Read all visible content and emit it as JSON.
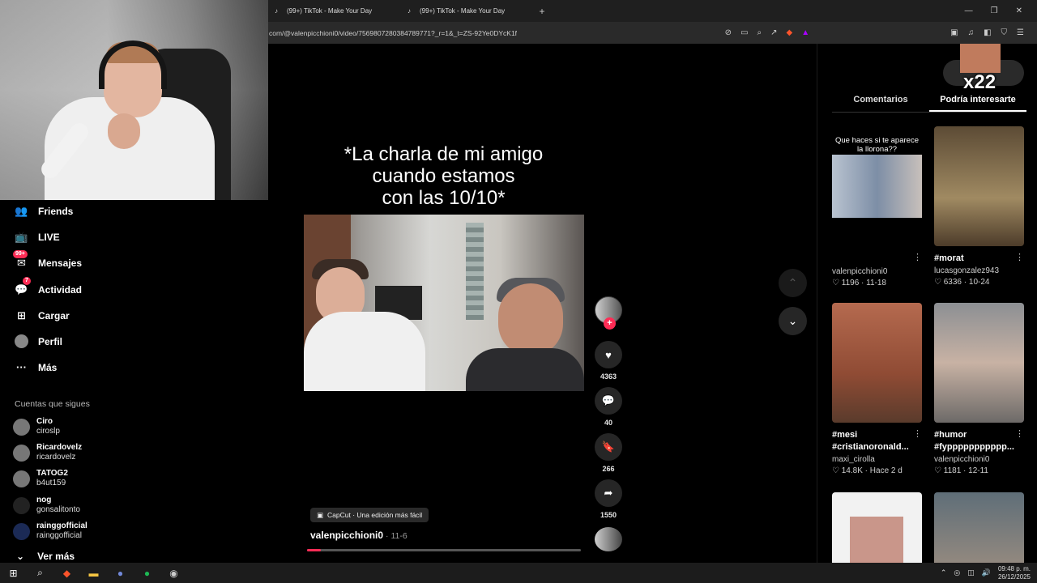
{
  "browser": {
    "tabs": [
      {
        "title": "(99+) TikTok - Make Your Day"
      },
      {
        "title": "(99+) TikTok - Make Your Day"
      }
    ],
    "new_tab": "+",
    "url": "com/@valenpicchioni0/video/7569807280384789771?_r=1&_t=ZS-92Ye0DYcK1f"
  },
  "sidebar": {
    "items": [
      {
        "label": "Friends",
        "icon": "friends-icon"
      },
      {
        "label": "LIVE",
        "icon": "live-icon"
      },
      {
        "label": "Mensajes",
        "icon": "messages-icon",
        "badge": "99+"
      },
      {
        "label": "Actividad",
        "icon": "activity-icon",
        "badge": "7"
      },
      {
        "label": "Cargar",
        "icon": "upload-icon"
      },
      {
        "label": "Perfil",
        "icon": "profile-icon"
      },
      {
        "label": "Más",
        "icon": "more-icon"
      }
    ],
    "following_title": "Cuentas que sigues",
    "following": [
      {
        "name": "Ciro",
        "handle": "ciroslp"
      },
      {
        "name": "Ricardovelz",
        "handle": "ricardovelz"
      },
      {
        "name": "TATOG2",
        "handle": "b4ut159"
      },
      {
        "name": "nog",
        "handle": "gonsalitonto"
      },
      {
        "name": "rainggofficial",
        "handle": "rainggofficial"
      }
    ],
    "see_more": "Ver más"
  },
  "video": {
    "caption_lines": [
      "*La charla de mi amigo",
      "cuando estamos",
      "con las 10/10*"
    ],
    "capcut": "CapCut · Una edición más fácil",
    "author": "valenpicchioni0",
    "date": "· 11-6",
    "progress": 0.05,
    "likes": "4363",
    "comments": "40",
    "saves": "266",
    "shares": "1550"
  },
  "right_panel": {
    "overlay_text": "x22",
    "tabs": [
      "Comentarios",
      "Podría interesarte"
    ],
    "cards": [
      {
        "title": "",
        "title2": "",
        "user": "valenpicchioni0",
        "likes": "1196",
        "date": "11-18",
        "thumb_text": "Que haces si te aparece la llorona??"
      },
      {
        "title": "#morat",
        "title2": "",
        "user": "lucasgonzalez943",
        "likes": "6336",
        "date": "10-24",
        "thumb_text": ""
      },
      {
        "title": "#mesi",
        "title2": "#cristianoronald...",
        "user": "maxi_cirolla",
        "likes": "14.8K",
        "date": "Hace 2 d",
        "thumb_text": ""
      },
      {
        "title": "#humor",
        "title2": "#fyppppppppppp...",
        "user": "valenpicchioni0",
        "likes": "1181",
        "date": "12-11",
        "thumb_text": ""
      }
    ]
  },
  "taskbar": {
    "time": "09:48 p. m.",
    "date": "26/12/2025"
  }
}
